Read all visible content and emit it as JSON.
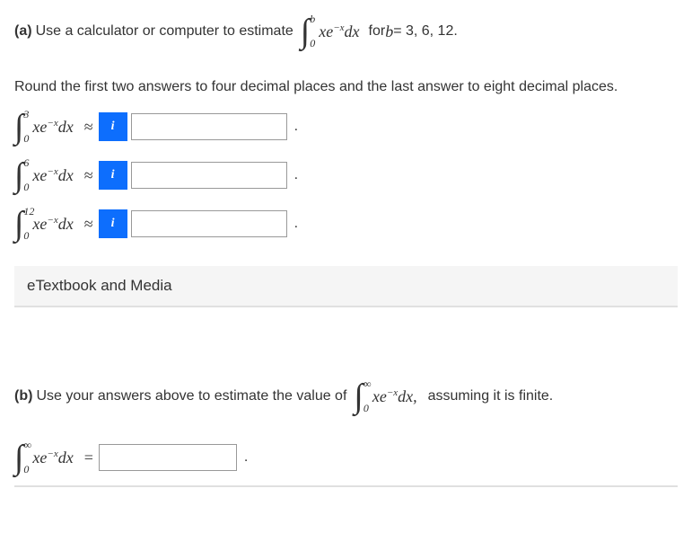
{
  "partA": {
    "label": "(a)",
    "prompt_before": "Use a calculator or computer to estimate",
    "top_integral": {
      "lower": "0",
      "upper": "b",
      "integrand_html": "xe<sup class='sup'>−x</sup>dx"
    },
    "prompt_after_prefix": "for ",
    "prompt_after_var": "b",
    "prompt_after_vals": " = 3, 6, 12.",
    "round_instruction": "Round the first two answers to four decimal places and the last answer to eight decimal places.",
    "rows": [
      {
        "lower": "0",
        "upper": "3",
        "integrand_html": "xe<sup class='sup'>−x</sup>dx",
        "approx": "≈"
      },
      {
        "lower": "0",
        "upper": "6",
        "integrand_html": "xe<sup class='sup'>−x</sup>dx",
        "approx": "≈"
      },
      {
        "lower": "0",
        "upper": "12",
        "integrand_html": "xe<sup class='sup'>−x</sup>dx",
        "approx": "≈"
      }
    ],
    "info_label": "i",
    "period": "."
  },
  "etm_label": "eTextbook and Media",
  "partB": {
    "label": "(b)",
    "prompt_before": "Use your answers above to estimate the value of",
    "inf_integral": {
      "lower": "0",
      "upper": "∞",
      "integrand_html": "xe<sup class='sup'>−x</sup>dx,"
    },
    "prompt_after": "assuming it is finite.",
    "final_integral": {
      "lower": "0",
      "upper": "∞",
      "integrand_html": "xe<sup class='sup'>−x</sup>dx"
    },
    "equals": "=",
    "period": "."
  }
}
